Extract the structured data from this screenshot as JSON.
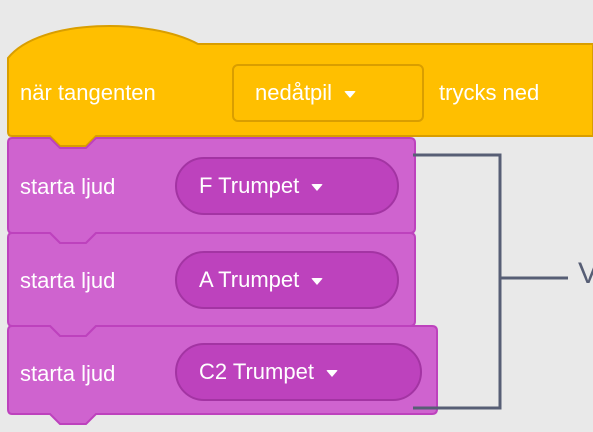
{
  "hat_block": {
    "prefix_label": "när tangenten",
    "key_dropdown_value": "nedåtpil",
    "suffix_label": "trycks ned"
  },
  "sound_blocks": [
    {
      "label": "starta ljud",
      "sound_value": "F Trumpet"
    },
    {
      "label": "starta ljud",
      "sound_value": "A Trumpet"
    },
    {
      "label": "starta ljud",
      "sound_value": "C2 Trumpet"
    }
  ],
  "bracket_annotation_text": "V",
  "colors": {
    "background": "#e9e9e9",
    "events_block": "#ffbf00",
    "sound_block": "#cf63cf",
    "sound_dropdown": "#bd42bd",
    "bracket": "#575e75"
  },
  "icons": [
    "dropdown-caret-icon"
  ]
}
